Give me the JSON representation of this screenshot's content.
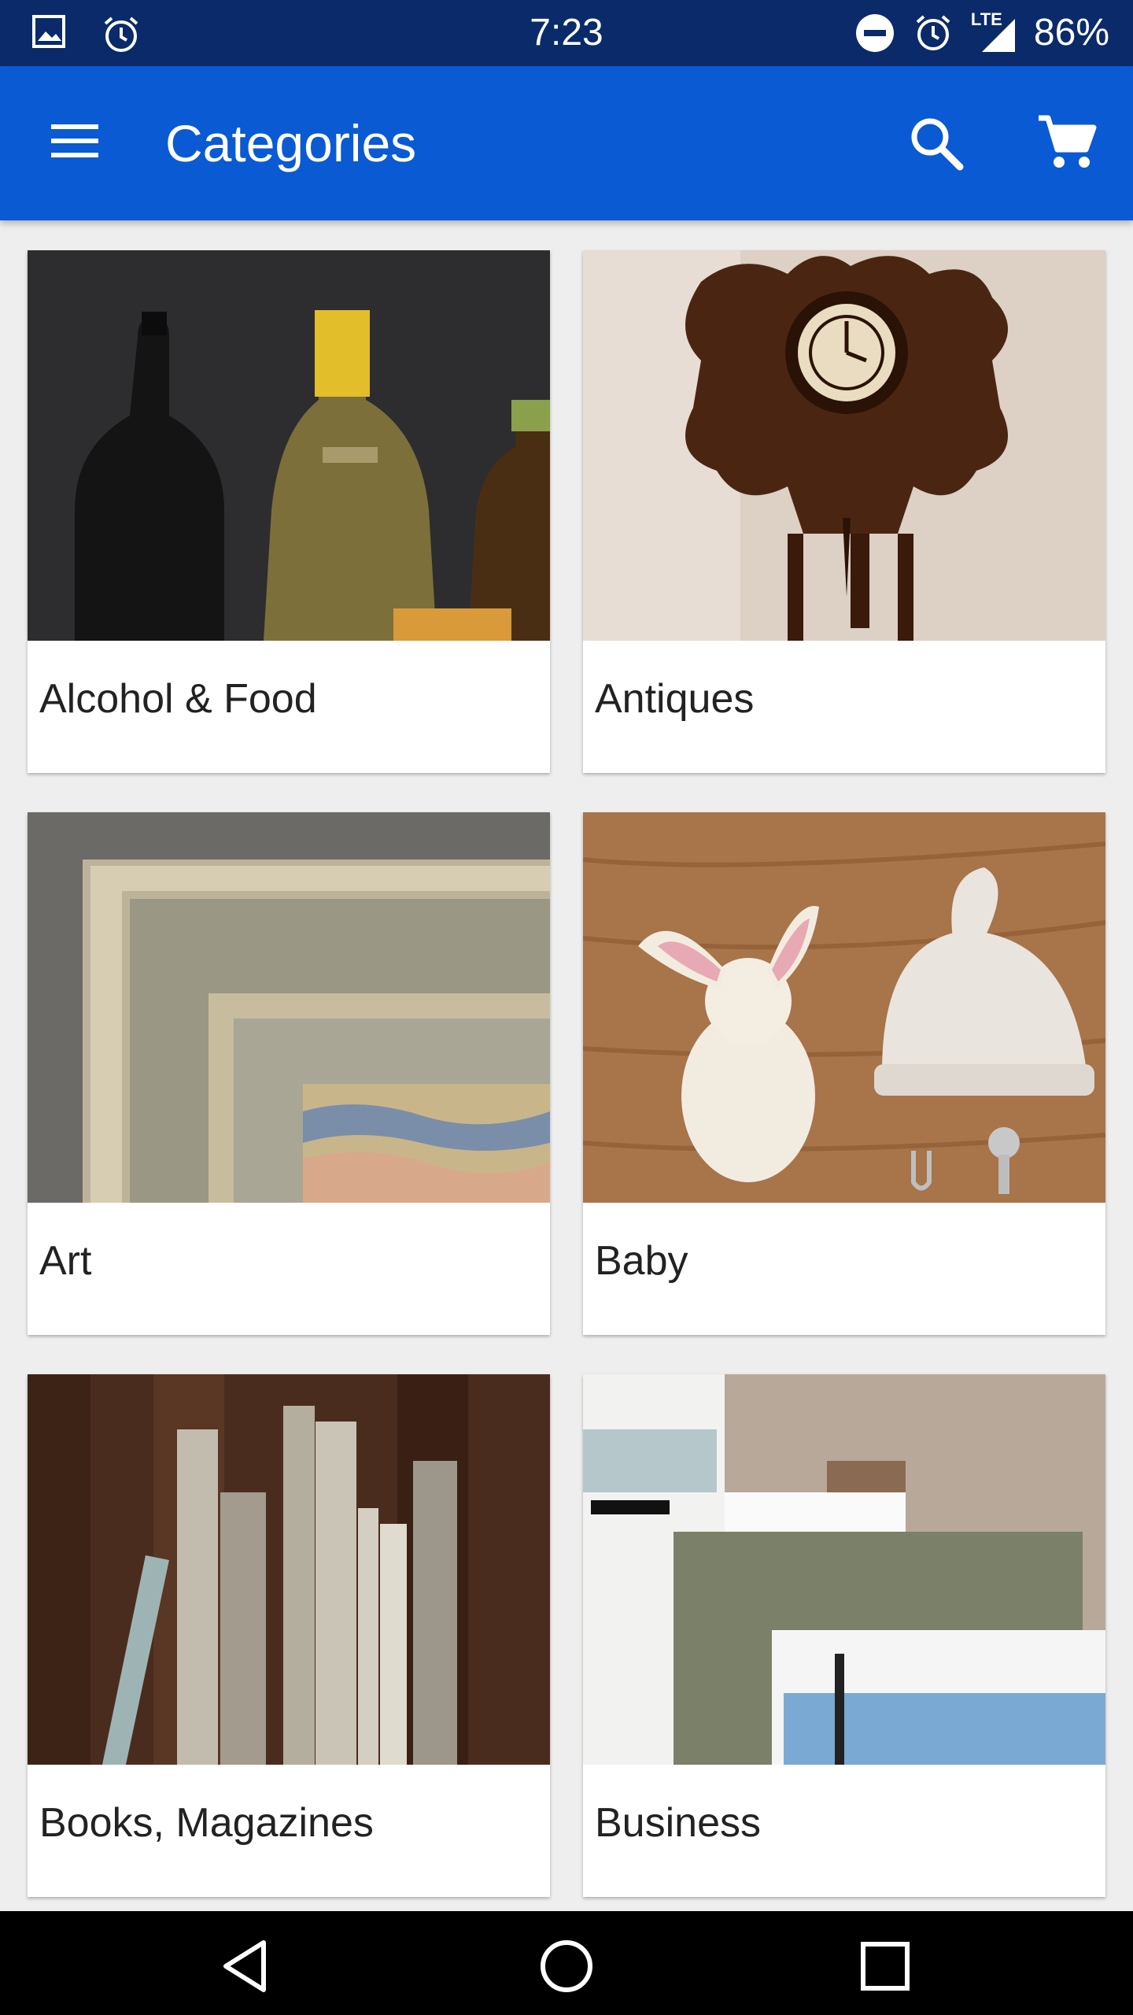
{
  "status": {
    "time": "7:23",
    "battery": "86%",
    "network": "LTE"
  },
  "appbar": {
    "title": "Categories"
  },
  "categories": [
    {
      "label": "Alcohol & Food"
    },
    {
      "label": "Antiques"
    },
    {
      "label": "Art"
    },
    {
      "label": "Baby"
    },
    {
      "label": "Books, Magazines"
    },
    {
      "label": "Business"
    }
  ],
  "colors": {
    "appbar": "#0a5ad3",
    "statusbar": "#0a2a6a"
  },
  "icons": [
    "menu-icon",
    "search-icon",
    "cart-icon",
    "back-icon",
    "home-icon",
    "recents-icon"
  ]
}
